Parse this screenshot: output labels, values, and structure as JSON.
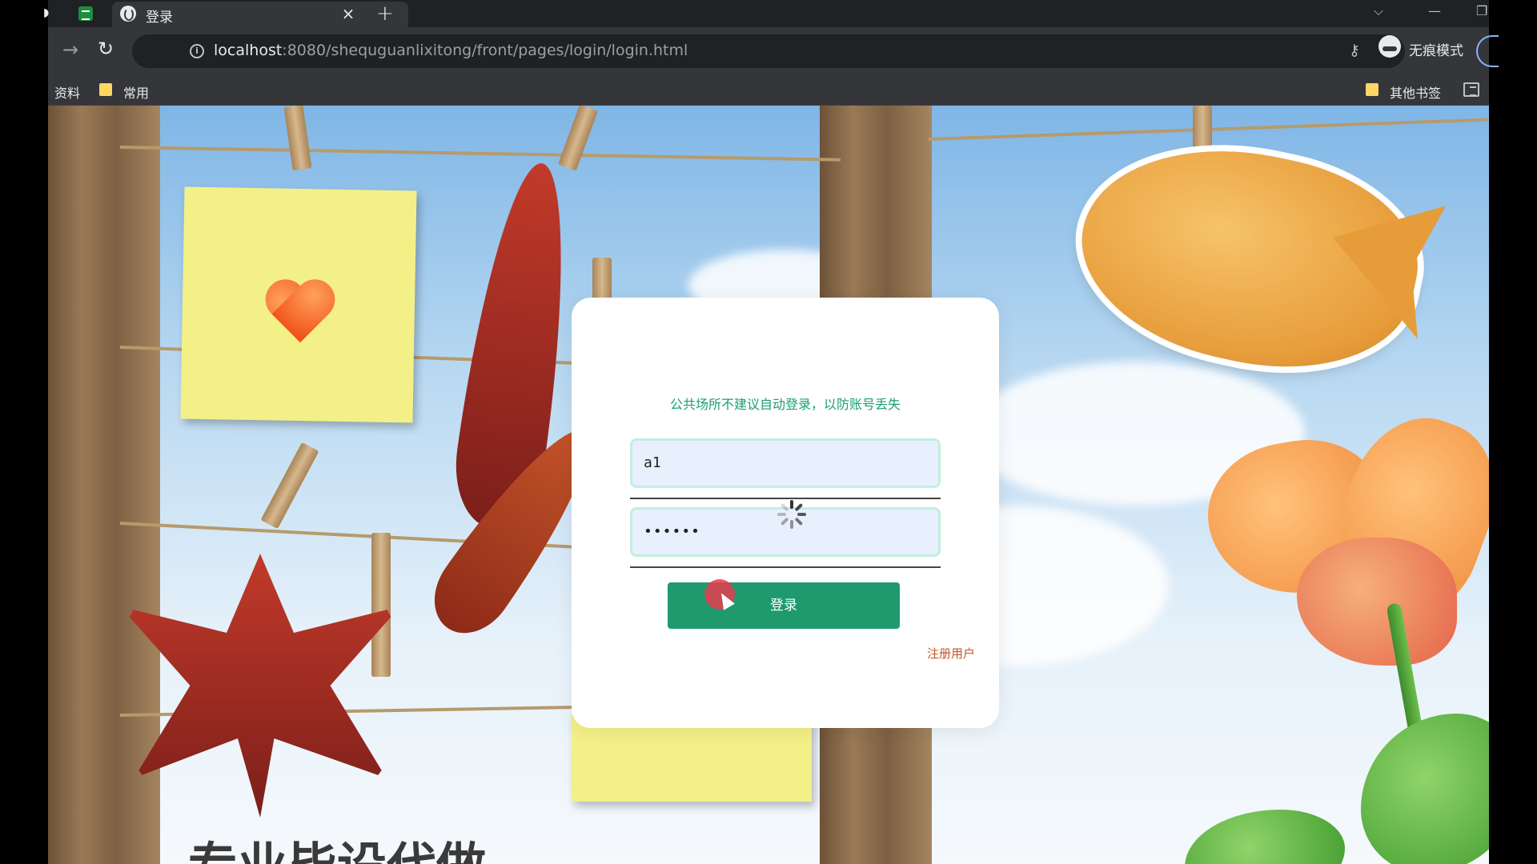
{
  "browser": {
    "tab_title": "登录",
    "tab_close": "×",
    "new_tab": "+",
    "url_host": "localhost",
    "url_path": ":8080/shequguanlixitong/front/pages/login/login.html",
    "incognito_label": "无痕模式",
    "bookmarks": [
      "资料",
      "常用"
    ],
    "other_bookmarks": "其他书签",
    "window_controls": {
      "tabs_list": "⌵",
      "minimize": "—",
      "restore": "❐"
    }
  },
  "login": {
    "notice": "公共场所不建议自动登录，以防账号丢失",
    "username_value": "a1",
    "password_value": "••••••",
    "submit_label": "登录",
    "register_label": "注册用户"
  },
  "background": {
    "banner_text": "专业毕设代做"
  },
  "icons": {
    "forward": "forward-arrow-icon",
    "reload": "reload-icon",
    "info": "info-icon",
    "key": "key-icon",
    "star": "star-icon",
    "incognito": "incognito-icon",
    "reading_list": "reading-list-icon",
    "spinner": "loading-spinner-icon"
  }
}
